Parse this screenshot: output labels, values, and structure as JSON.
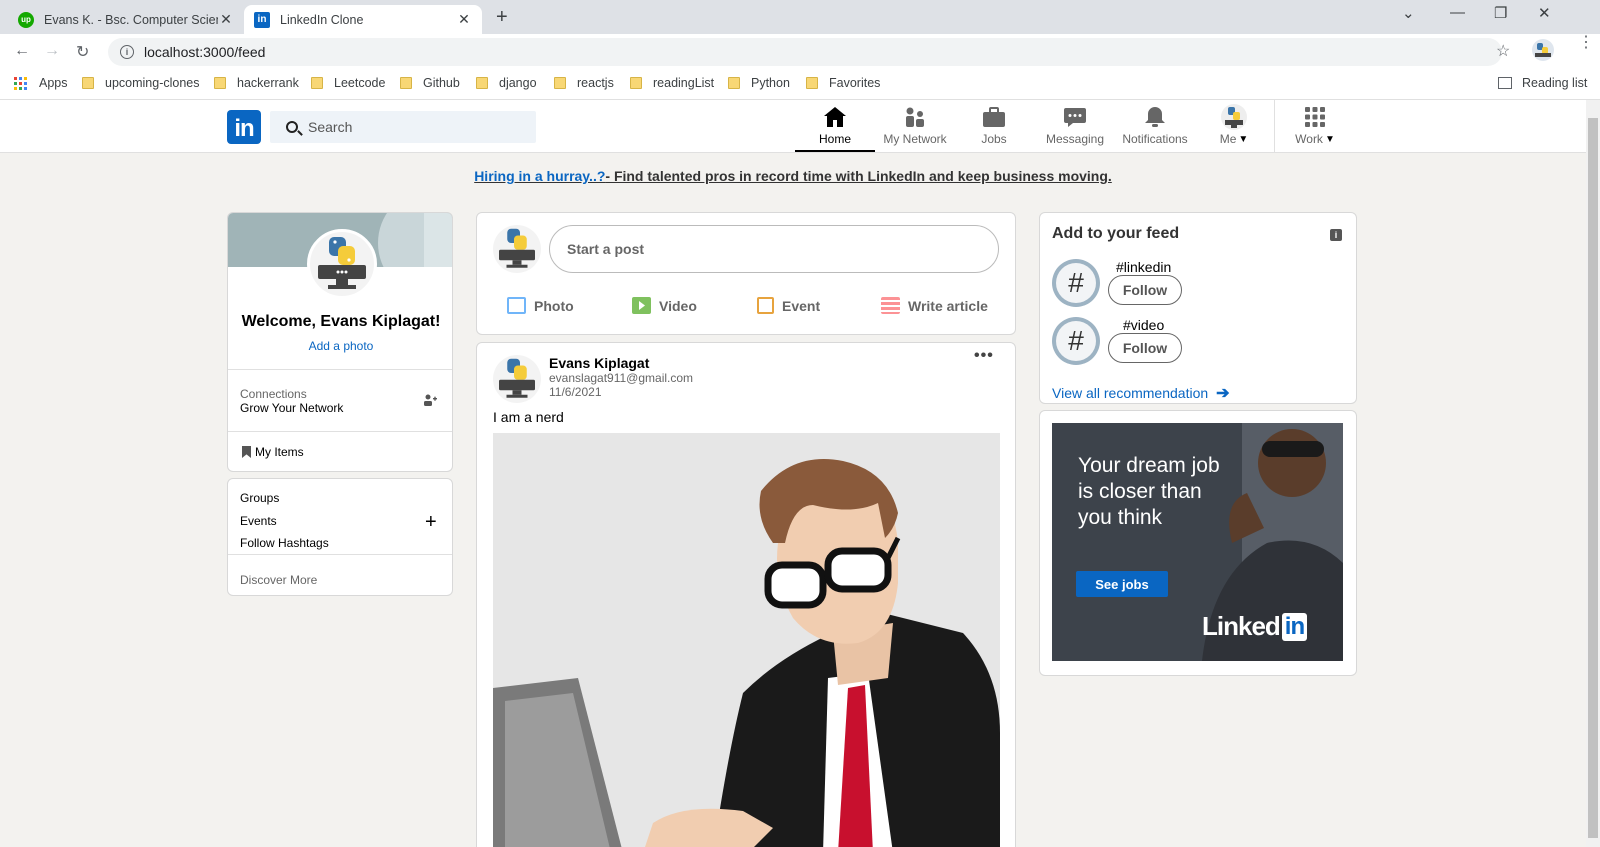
{
  "browser": {
    "tabs": [
      {
        "title": "Evans K. - Bsc. Computer Science"
      },
      {
        "title": "LinkedIn Clone"
      }
    ],
    "url": "localhost:3000/feed",
    "bookmarks": [
      "Apps",
      "upcoming-clones",
      "hackerrank",
      "Leetcode",
      "Github",
      "django",
      "reactjs",
      "readingList",
      "Python",
      "Favorites"
    ],
    "reading_list": "Reading list"
  },
  "header": {
    "search_placeholder": "Search",
    "nav": [
      {
        "label": "Home",
        "icon": "home-icon"
      },
      {
        "label": "My Network",
        "icon": "network-icon"
      },
      {
        "label": "Jobs",
        "icon": "briefcase-icon"
      },
      {
        "label": "Messaging",
        "icon": "messaging-icon"
      },
      {
        "label": "Notifications",
        "icon": "bell-icon"
      },
      {
        "label": "Me",
        "icon": "avatar-icon"
      },
      {
        "label": "Work",
        "icon": "grid-icon"
      }
    ]
  },
  "banner": {
    "link": "Hiring in a hurray..?",
    "text": "- Find talented pros in record time with LinkedIn and keep business moving."
  },
  "left": {
    "welcome": "Welcome, Evans Kiplagat!",
    "add_photo": "Add a photo",
    "connections_label": "Connections",
    "connections_sub": "Grow Your Network",
    "my_items": "My Items",
    "groups": "Groups",
    "events": "Events",
    "follow_hashtags": "Follow Hashtags",
    "discover": "Discover More"
  },
  "share": {
    "placeholder": "Start a post",
    "actions": [
      {
        "label": "Photo",
        "color": "#70b5f9"
      },
      {
        "label": "Video",
        "color": "#7fc15e"
      },
      {
        "label": "Event",
        "color": "#e7a33e"
      },
      {
        "label": "Write article",
        "color": "#fc9295"
      }
    ]
  },
  "post": {
    "author": "Evans Kiplagat",
    "email": "evanslagat911@gmail.com",
    "date": "11/6/2021",
    "text": "I am a nerd"
  },
  "feed": {
    "title": "Add to your feed",
    "hashtags": [
      {
        "name": "#linkedin",
        "follow": "Follow"
      },
      {
        "name": "#video",
        "follow": "Follow"
      }
    ],
    "view_all": "View all recommendation"
  },
  "ad": {
    "text": "Your dream job is closer than you think",
    "cta": "See jobs",
    "brand_text": "Linked",
    "brand_in": "in"
  },
  "colors": {
    "brand": "#0a66c2",
    "background": "#f3f2ef"
  }
}
